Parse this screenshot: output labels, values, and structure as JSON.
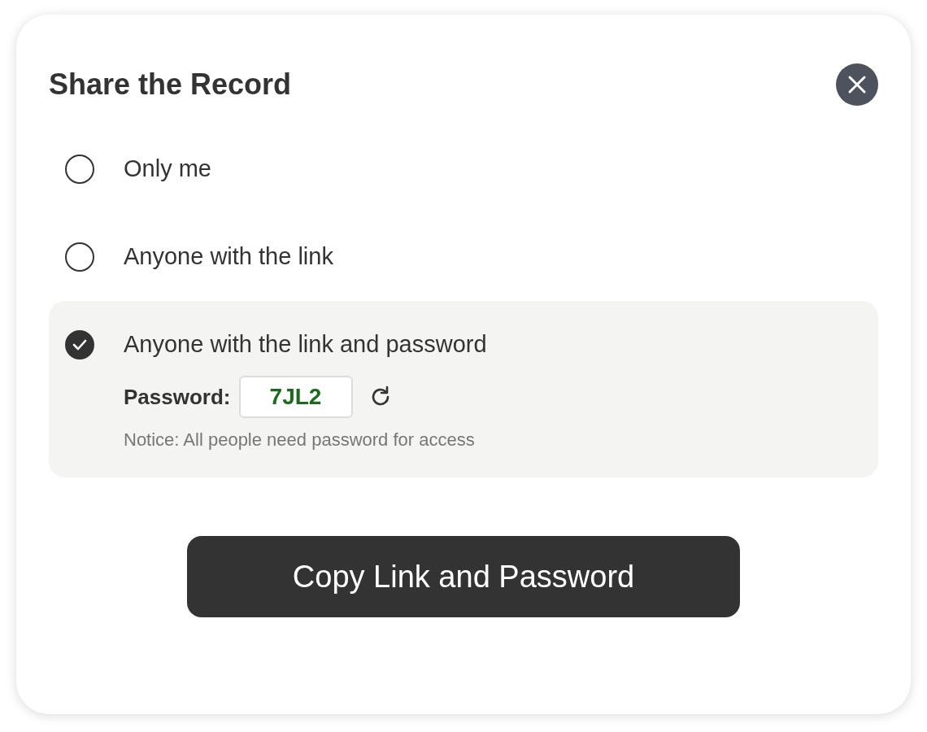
{
  "dialog": {
    "title": "Share the Record"
  },
  "options": [
    {
      "label": "Only me",
      "selected": false
    },
    {
      "label": "Anyone with the link",
      "selected": false
    },
    {
      "label": "Anyone with the link and password",
      "selected": true,
      "password": {
        "label": "Password:",
        "value": "7JL2"
      },
      "notice": "Notice: All people need password for access"
    }
  ],
  "button": {
    "label": "Copy Link and Password"
  }
}
